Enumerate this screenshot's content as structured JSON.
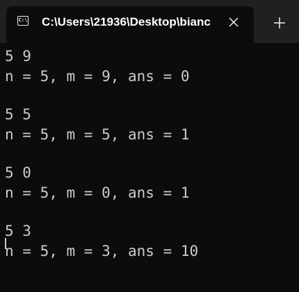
{
  "tab": {
    "icon": "terminal-icon",
    "icon_glyph": "C:\\",
    "title": "C:\\Users\\21936\\Desktop\\bianc",
    "close": "close-icon",
    "new_tab": "plus-icon"
  },
  "terminal": {
    "lines": [
      "5 9",
      "n = 5, m = 9, ans = 0",
      "",
      "5 5",
      "n = 5, m = 5, ans = 1",
      "",
      "5 0",
      "n = 5, m = 0, ans = 1",
      "",
      "5 3",
      "n = 5, m = 3, ans = 10"
    ]
  },
  "colors": {
    "tabbar_bg": "#202020",
    "terminal_bg": "#0c0c0c",
    "text": "#cccccc"
  }
}
